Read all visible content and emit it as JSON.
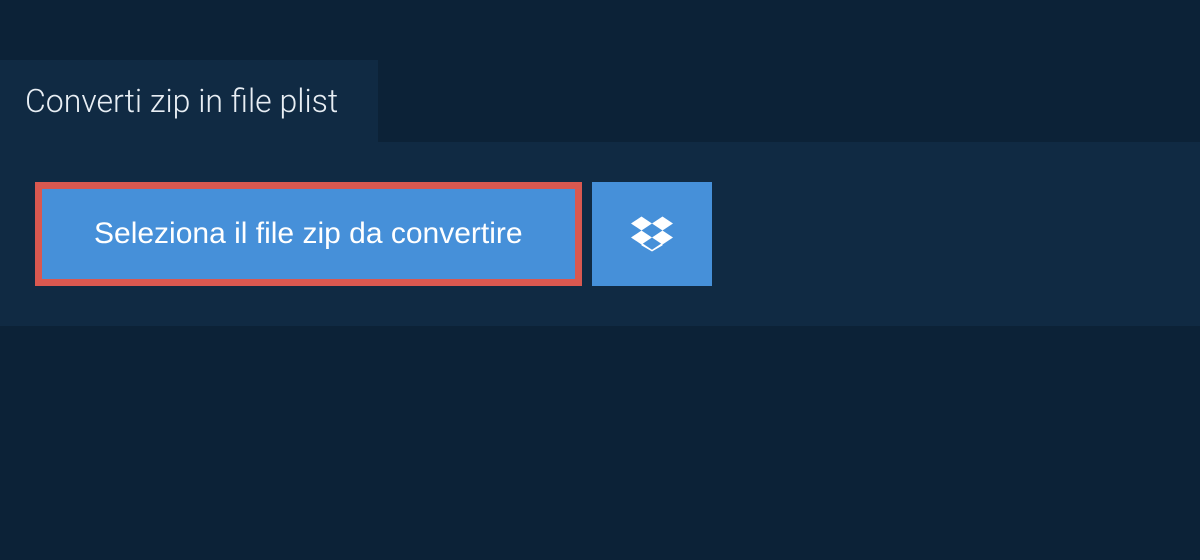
{
  "tab": {
    "title": "Converti zip in file plist"
  },
  "actions": {
    "select_file_label": "Seleziona il file zip da convertire",
    "dropbox_icon_name": "dropbox"
  },
  "colors": {
    "background": "#0c2237",
    "panel": "#102a43",
    "button": "#4690d9",
    "highlight_border": "#d95850"
  }
}
